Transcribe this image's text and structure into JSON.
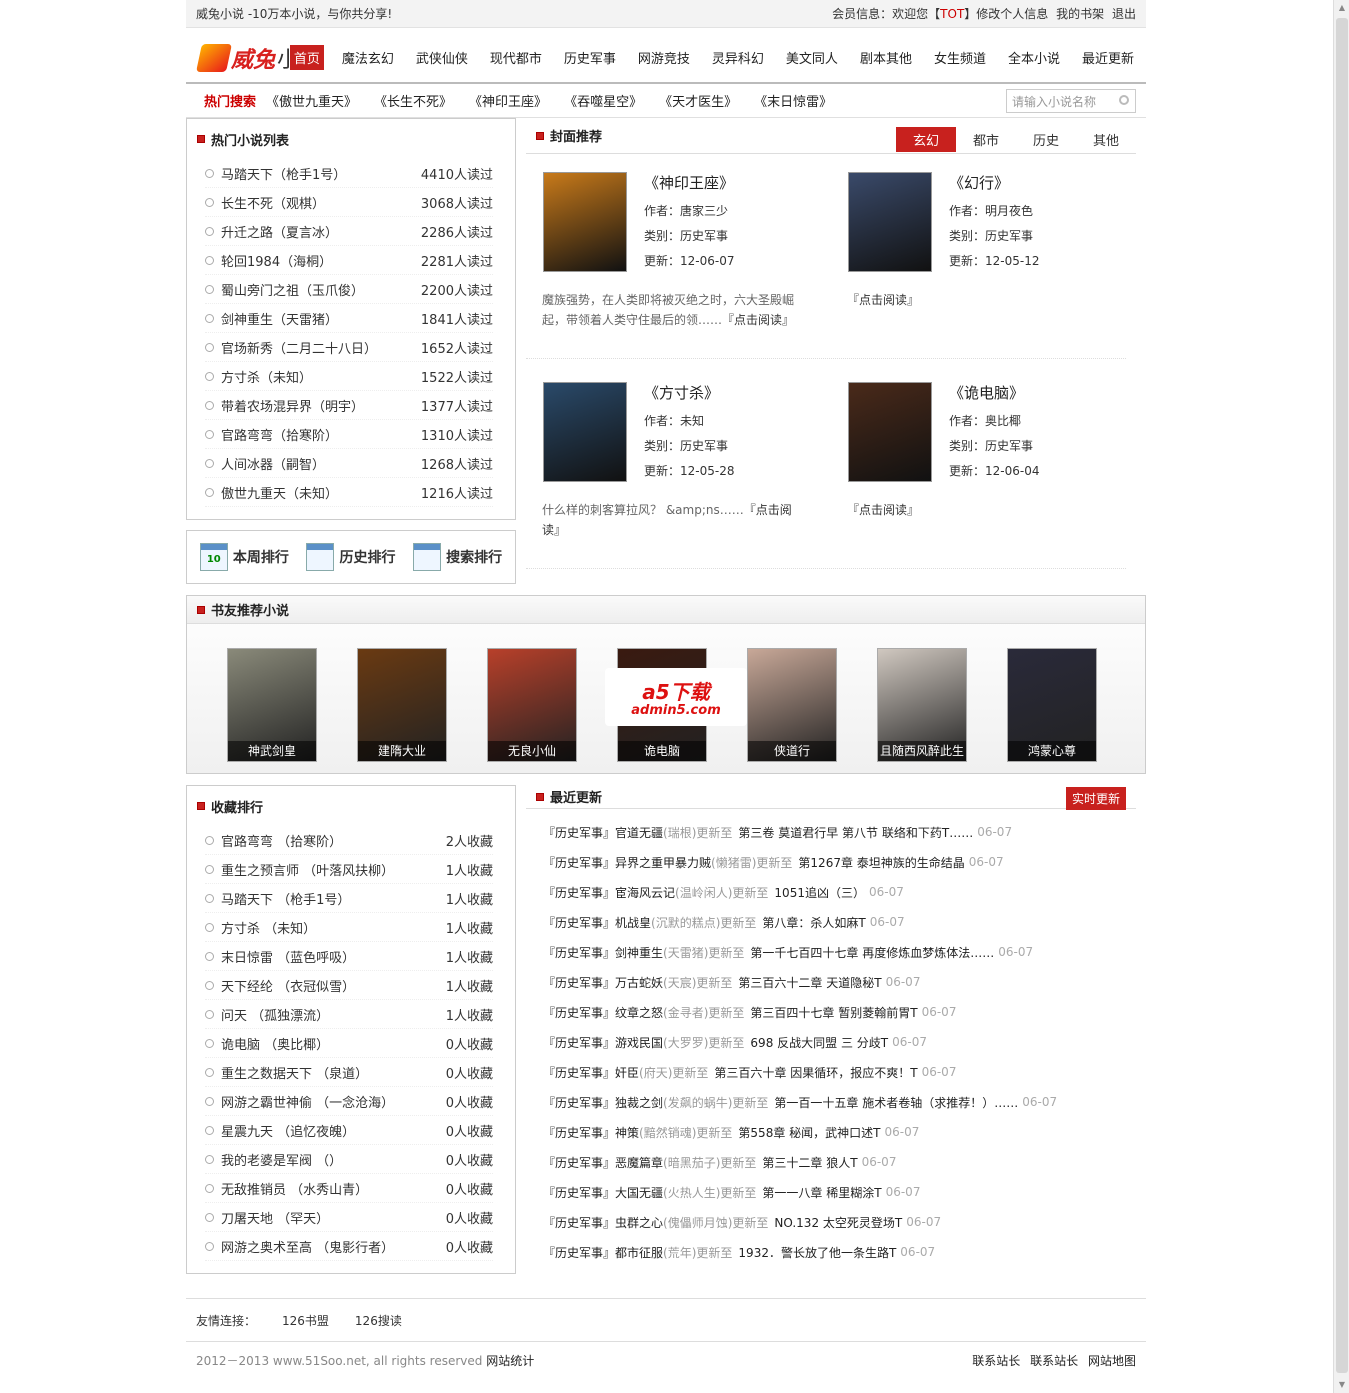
{
  "topbar": {
    "site_slogan": "威兔小说 -10万本小说，与你共分享!",
    "member_prefix": "会员信息：欢迎您【",
    "username": "TOT",
    "member_suffix": "】",
    "edit_profile": "修改个人信息",
    "my_shelf": "我的书架",
    "logout": "退出"
  },
  "logo": {
    "part1": "威兔",
    "part2": "小说"
  },
  "nav": [
    "首页",
    "魔法玄幻",
    "武侠仙侠",
    "现代都市",
    "历史军事",
    "网游竞技",
    "灵异科幻",
    "美文同人",
    "剧本其他",
    "女生频道",
    "全本小说",
    "最近更新"
  ],
  "hot_search": {
    "label": "热门搜索",
    "keywords": [
      "《傲世九重天》",
      "《长生不死》",
      "《神印王座》",
      "《吞噬星空》",
      "《天才医生》",
      "《末日惊雷》"
    ],
    "placeholder": "请输入小说名称"
  },
  "hot_list": {
    "title": "热门小说列表",
    "items": [
      {
        "title": "马踏天下（枪手1号）",
        "count": "4410人读过"
      },
      {
        "title": "长生不死（观棋）",
        "count": "3068人读过"
      },
      {
        "title": "升迁之路（夏言冰）",
        "count": "2286人读过"
      },
      {
        "title": "轮回1984（海桐）",
        "count": "2281人读过"
      },
      {
        "title": "蜀山旁门之祖（玉爪俊）",
        "count": "2200人读过"
      },
      {
        "title": "剑神重生（天雷猪）",
        "count": "1841人读过"
      },
      {
        "title": "官场新秀（二月二十八日）",
        "count": "1652人读过"
      },
      {
        "title": "方寸杀（未知）",
        "count": "1522人读过"
      },
      {
        "title": "带着农场混异界（明宇）",
        "count": "1377人读过"
      },
      {
        "title": "官路弯弯（拾寒阶）",
        "count": "1310人读过"
      },
      {
        "title": "人间冰器（嗣智）",
        "count": "1268人读过"
      },
      {
        "title": "傲世九重天（未知）",
        "count": "1216人读过"
      }
    ]
  },
  "rank_buttons": {
    "week": "本周排行",
    "history": "历史排行",
    "search": "搜索排行",
    "cal_day": "10"
  },
  "cover": {
    "title": "封面推荐",
    "tabs": [
      "玄幻",
      "都市",
      "历史",
      "其他"
    ],
    "books": [
      {
        "title": "《神印王座》",
        "author": "作者：唐家三少",
        "category": "类别：历史军事",
        "updated": "更新：12-06-07",
        "desc": "魔族强势，在人类即将被灭绝之时，六大圣殿崛起，带领着人类守住最后的领……",
        "read": "『点击阅读』",
        "cover_color": "#c87a1a"
      },
      {
        "title": "《幻行》",
        "author": "作者：明月夜色",
        "category": "类别：历史军事",
        "updated": "更新：12-05-12",
        "desc": "",
        "read": "『点击阅读』",
        "cover_color": "#3a4a6a"
      },
      {
        "title": "《方寸杀》",
        "author": "作者：未知",
        "category": "类别：历史军事",
        "updated": "更新：12-05-28",
        "desc": "什么样的刺客算拉风？ &amp;ns……",
        "read": "『点击阅读』",
        "cover_color": "#2a4a6a"
      },
      {
        "title": "《诡电脑》",
        "author": "作者：奥比椰",
        "category": "类别：历史军事",
        "updated": "更新：12-06-04",
        "desc": "",
        "read": "『点击阅读』",
        "cover_color": "#4a2a1a"
      }
    ]
  },
  "friends": {
    "title": "书友推荐小说",
    "books": [
      {
        "name": "神武剑皇",
        "cover_color": "#8a8a7a"
      },
      {
        "name": "建隋大业",
        "cover_color": "#6a3a12"
      },
      {
        "name": "无良小仙",
        "cover_color": "#b8402a"
      },
      {
        "name": "诡电脑",
        "cover_color": "#3a1a10"
      },
      {
        "name": "侠道行",
        "cover_color": "#c8a898"
      },
      {
        "name": "且随西风醉此生",
        "cover_color": "#d0c8c0"
      },
      {
        "name": "鸿蒙心尊",
        "cover_color": "#2a2a3a"
      }
    ],
    "watermark_l1": "a5下载",
    "watermark_l2": "admin5.com"
  },
  "collection": {
    "title": "收藏排行",
    "items": [
      {
        "title": "官路弯弯 （拾寒阶）",
        "count": "2人收藏"
      },
      {
        "title": "重生之预言师 （叶落风扶柳）",
        "count": "1人收藏"
      },
      {
        "title": "马踏天下 （枪手1号）",
        "count": "1人收藏"
      },
      {
        "title": "方寸杀 （未知）",
        "count": "1人收藏"
      },
      {
        "title": "末日惊雷 （蓝色呼吸）",
        "count": "1人收藏"
      },
      {
        "title": "天下经纶 （衣冠似雪）",
        "count": "1人收藏"
      },
      {
        "title": "问天 （孤独漂流）",
        "count": "1人收藏"
      },
      {
        "title": "诡电脑 （奥比椰）",
        "count": "0人收藏"
      },
      {
        "title": "重生之数据天下 （泉道）",
        "count": "0人收藏"
      },
      {
        "title": "网游之霸世神偷 （一念沧海）",
        "count": "0人收藏"
      },
      {
        "title": "星震九天 （追忆夜魄）",
        "count": "0人收藏"
      },
      {
        "title": "我的老婆是军阀 （）",
        "count": "0人收藏"
      },
      {
        "title": "无敌推销员 （水秀山青）",
        "count": "0人收藏"
      },
      {
        "title": "刀屠天地 （罕天）",
        "count": "0人收藏"
      },
      {
        "title": "网游之奥术至高 （鬼影行者）",
        "count": "0人收藏"
      }
    ]
  },
  "recent": {
    "title": "最近更新",
    "realtime": "实时更新",
    "items": [
      {
        "cat": "『历史军事』",
        "book": "官道无疆",
        "author": "(瑞根)",
        "up": "更新至",
        "chapter": "第三卷 莫道君行早 第八节 联络和下药T……",
        "date": "06-07"
      },
      {
        "cat": "『历史军事』",
        "book": "异界之重甲暴力贼",
        "author": "(懒猪雷)",
        "up": "更新至",
        "chapter": "第1267章 泰坦神族的生命结晶",
        "date": "06-07"
      },
      {
        "cat": "『历史军事』",
        "book": "宦海风云记",
        "author": "(温岭闲人)",
        "up": "更新至",
        "chapter": "1051追凶（三）",
        "date": "06-07"
      },
      {
        "cat": "『历史军事』",
        "book": "机战皇",
        "author": "(沉默的糕点)",
        "up": "更新至",
        "chapter": "第八章：杀人如麻T",
        "date": "06-07"
      },
      {
        "cat": "『历史军事』",
        "book": "剑神重生",
        "author": "(天雷猪)",
        "up": "更新至",
        "chapter": "第一千七百四十七章 再度修炼血梦炼体法……",
        "date": "06-07"
      },
      {
        "cat": "『历史军事』",
        "book": "万古蛇妖",
        "author": "(天宸)",
        "up": "更新至",
        "chapter": "第三百六十二章 天道隐秘T",
        "date": "06-07"
      },
      {
        "cat": "『历史军事』",
        "book": "纹章之怒",
        "author": "(金寻者)",
        "up": "更新至",
        "chapter": "第三百四十七章 暂别菱翰前胃T",
        "date": "06-07"
      },
      {
        "cat": "『历史军事』",
        "book": "游戏民国",
        "author": "(大罗罗)",
        "up": "更新至",
        "chapter": "698 反战大同盟 三 分歧T",
        "date": "06-07"
      },
      {
        "cat": "『历史军事』",
        "book": "奸臣",
        "author": "(府天)",
        "up": "更新至",
        "chapter": "第三百六十章 因果循环，报应不爽！T",
        "date": "06-07"
      },
      {
        "cat": "『历史军事』",
        "book": "独裁之剑",
        "author": "(发飙的蜗牛)",
        "up": "更新至",
        "chapter": "第一百一十五章 施术者卷轴（求推荐！）……",
        "date": "06-07"
      },
      {
        "cat": "『历史军事』",
        "book": "神策",
        "author": "(黯然销魂)",
        "up": "更新至",
        "chapter": "第558章 秘闻，武神口述T",
        "date": "06-07"
      },
      {
        "cat": "『历史军事』",
        "book": "恶魔篇章",
        "author": "(暗黑茄子)",
        "up": "更新至",
        "chapter": "第三十二章 狼人T",
        "date": "06-07"
      },
      {
        "cat": "『历史军事』",
        "book": "大国无疆",
        "author": "(火热人生)",
        "up": "更新至",
        "chapter": "第一一八章 稀里糊涂T",
        "date": "06-07"
      },
      {
        "cat": "『历史军事』",
        "book": "虫群之心",
        "author": "(傀儡师月蚀)",
        "up": "更新至",
        "chapter": "NO.132 太空死灵登场T",
        "date": "06-07"
      },
      {
        "cat": "『历史军事』",
        "book": "都市征服",
        "author": "(荒年)",
        "up": "更新至",
        "chapter": "1932．警长放了他一条生路T",
        "date": "06-07"
      }
    ]
  },
  "friend_links": {
    "label": "友情连接：",
    "items": [
      "126书盟",
      "126搜读"
    ]
  },
  "footer": {
    "copyright": "2012－2013 www.51Soo.net, all rights reserved",
    "stat": "网站统计",
    "links": [
      "联系站长",
      "联系站长",
      "网站地图"
    ]
  },
  "colors": {
    "accent": "#c8211e",
    "border": "#cccccc"
  }
}
